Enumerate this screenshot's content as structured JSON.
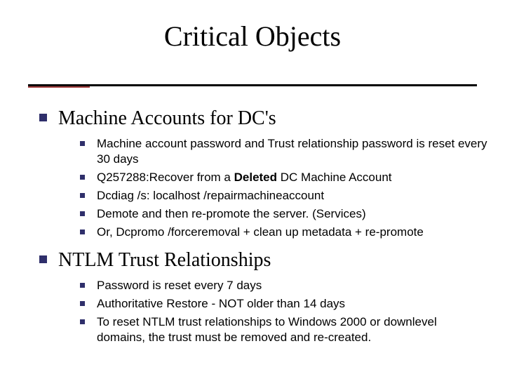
{
  "title": "Critical Objects",
  "sections": [
    {
      "heading": "Machine Accounts for DC's",
      "items": [
        {
          "text": "Machine account password and Trust relationship password is reset every 30 days"
        },
        {
          "prefix": "Q257288:Recover from a ",
          "bold": "Deleted",
          "suffix": " DC Machine Account"
        },
        {
          "text": "Dcdiag /s: localhost /repairmachineaccount"
        },
        {
          "text": "Demote and then re-promote the server. (Services)"
        },
        {
          "text": "Or, Dcpromo /forceremoval + clean up metadata + re-promote"
        }
      ]
    },
    {
      "heading": "NTLM Trust Relationships",
      "items": [
        {
          "text": "Password is reset every 7 days"
        },
        {
          "text": "Authoritative Restore - NOT older than 14 days"
        },
        {
          "text": "To reset NTLM trust relationships to Windows 2000 or downlevel domains, the trust must be removed and re-created."
        }
      ]
    }
  ]
}
